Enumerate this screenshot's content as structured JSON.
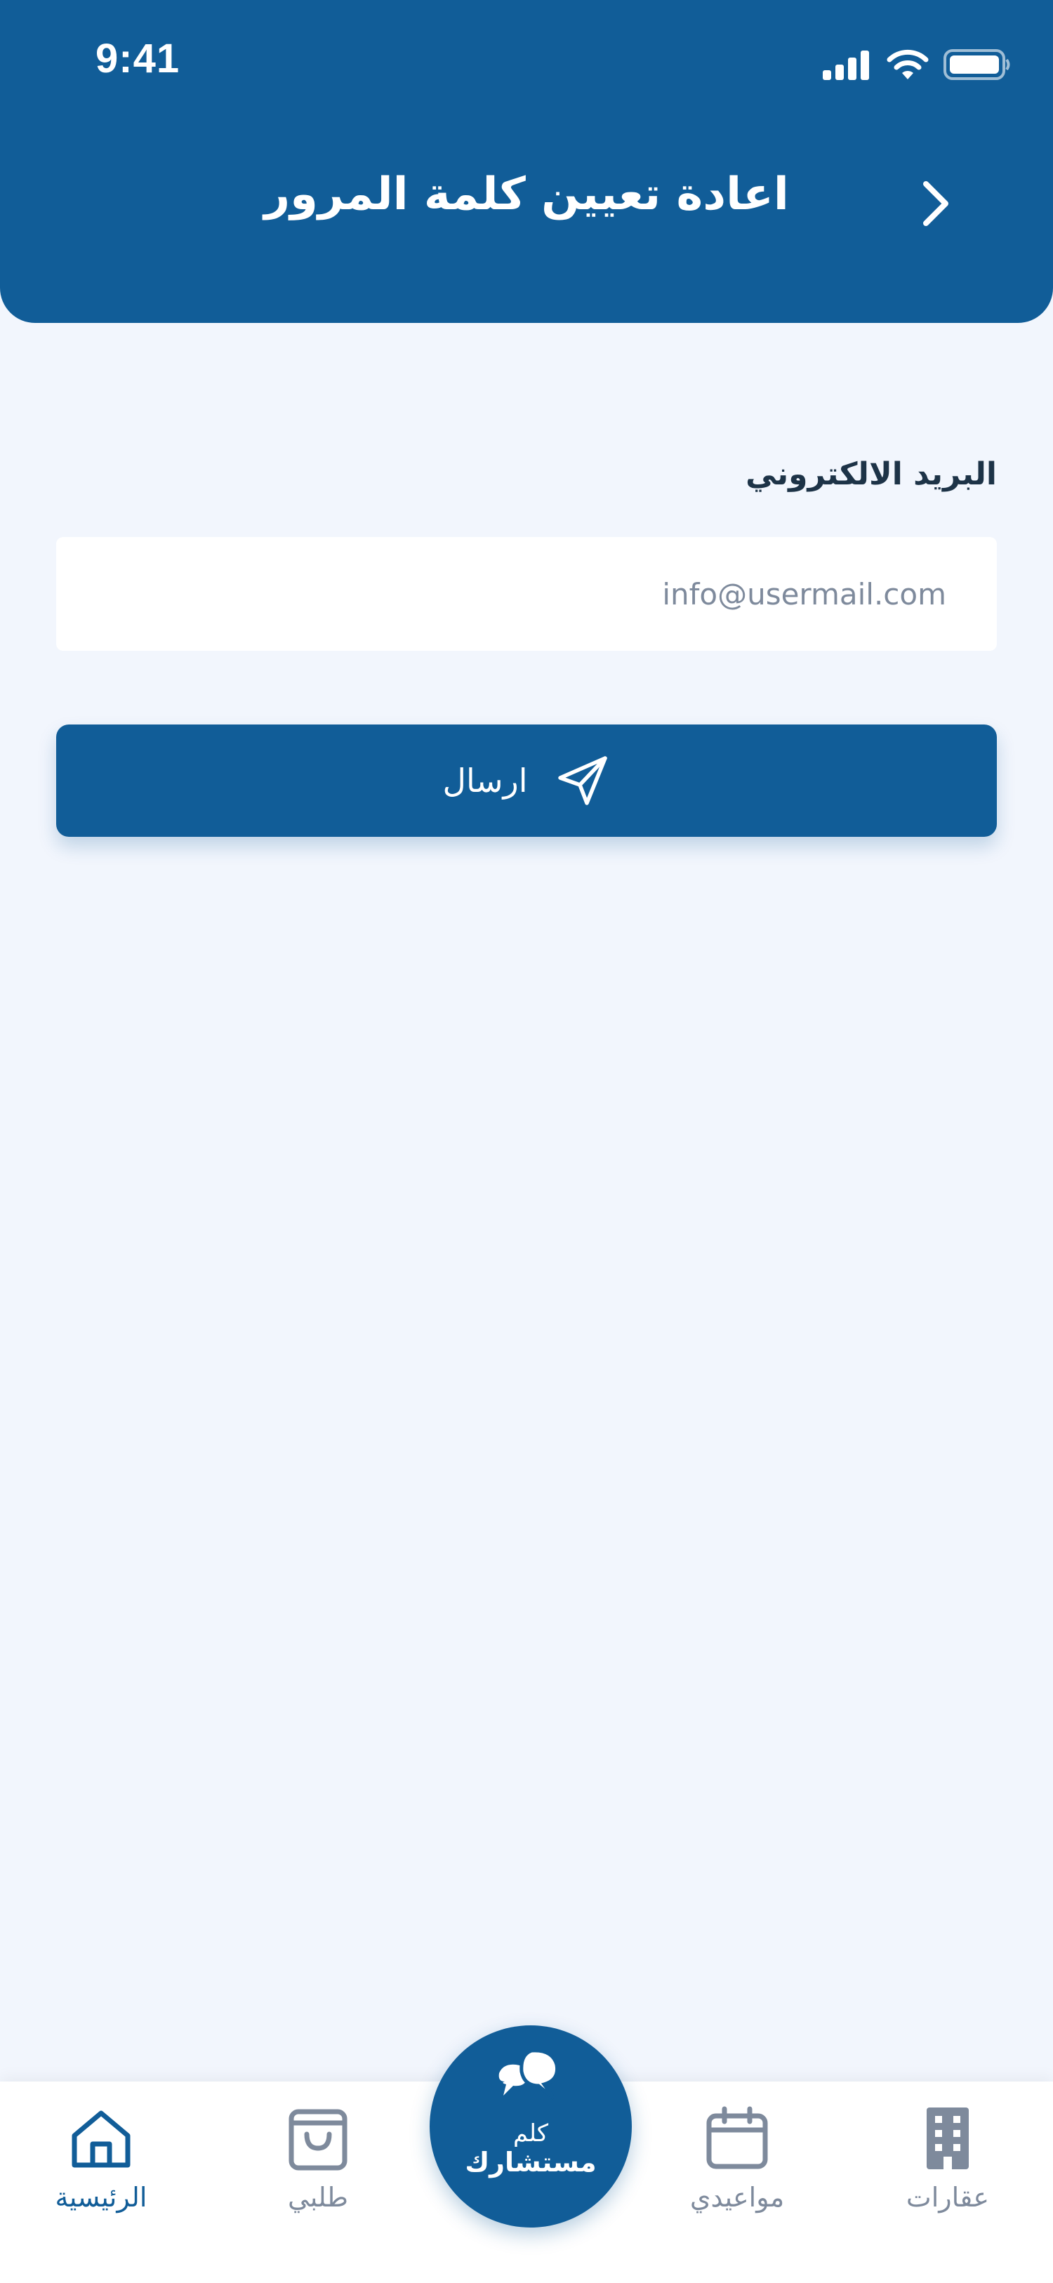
{
  "status_bar": {
    "time": "9:41"
  },
  "header": {
    "title": "اعادة تعيين كلمة المرور"
  },
  "form": {
    "email_label": "البريد الالكتروني",
    "email_placeholder": "info@usermail.com",
    "submit_label": "ارسال"
  },
  "consult": {
    "line1": "كلم",
    "line2": "مستشارك"
  },
  "nav": {
    "items": [
      {
        "label": "الرئيسية",
        "icon": "home-icon",
        "active": true
      },
      {
        "label": "طلبي",
        "icon": "shopping-bag-icon",
        "active": false
      },
      {
        "label": "مواعيدي",
        "icon": "calendar-icon",
        "active": false
      },
      {
        "label": "عقارات",
        "icon": "building-icon",
        "active": false
      }
    ]
  },
  "colors": {
    "primary": "#115D98",
    "background": "#F2F6FD",
    "label_text": "#1D3347",
    "muted": "#7E8A9C"
  }
}
